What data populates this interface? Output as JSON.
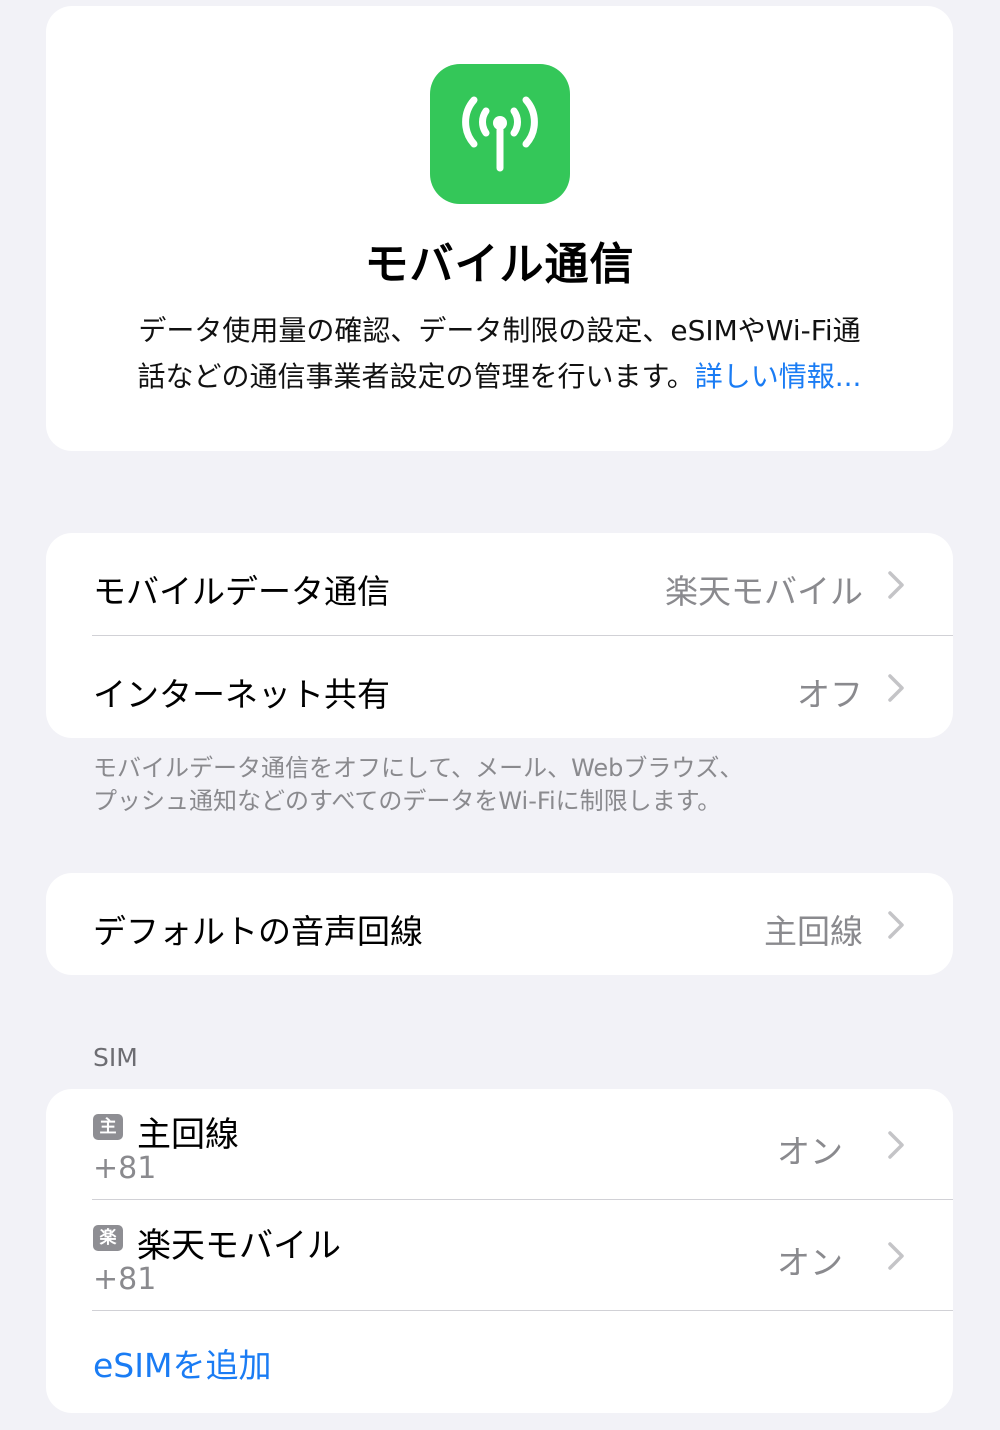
{
  "header": {
    "icon": "antenna-signal-icon",
    "icon_color": "#34c759",
    "title": "モバイル通信",
    "description_line1": "データ使用量の確認、データ制限の設定、eSIMやWi-Fi通",
    "description_line2": "話などの通信事業者設定の管理を行います。",
    "learn_more": "詳しい情報..."
  },
  "cellular_group": {
    "rows": [
      {
        "label": "モバイルデータ通信",
        "value": "楽天モバイル"
      },
      {
        "label": "インターネット共有",
        "value": "オフ"
      }
    ],
    "footnote_line1": "モバイルデータ通信をオフにして、メール、Webブラウズ、",
    "footnote_line2": "プッシュ通知などのすべてのデータをWi-Fiに制限します。"
  },
  "voice_group": {
    "rows": [
      {
        "label": "デフォルトの音声回線",
        "value": "主回線"
      }
    ]
  },
  "sim_section": {
    "header": "SIM",
    "sims": [
      {
        "badge": "主",
        "name": "主回線",
        "number": "+81",
        "status": "オン"
      },
      {
        "badge": "楽",
        "name": "楽天モバイル",
        "number": "+81",
        "status": "オン"
      }
    ],
    "add_esim": "eSIMを追加"
  },
  "colors": {
    "background": "#f2f2f7",
    "card": "#ffffff",
    "link": "#1a7cf4",
    "secondary_text": "#8a8a8e",
    "badge": "#8e8e93"
  }
}
